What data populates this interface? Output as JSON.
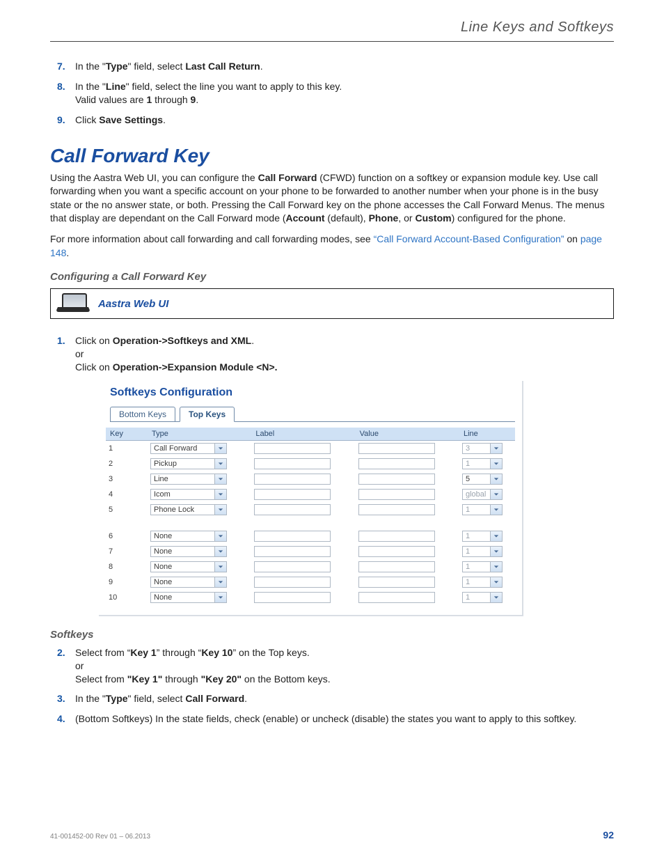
{
  "header": {
    "running_title": "Line Keys and Softkeys"
  },
  "intro_steps": [
    {
      "n": "7.",
      "pre": "In the \"",
      "bold1": "Type",
      "mid": "\" field, select ",
      "bold2": "Last Call Return",
      "post": "."
    },
    {
      "n": "8.",
      "pre": "In the \"",
      "bold1": "Line",
      "mid": "\" field, select the line you want to apply to this key.",
      "sub_pre": "Valid values are ",
      "sub_b1": "1",
      "sub_mid": " through ",
      "sub_b2": "9",
      "sub_post": "."
    },
    {
      "n": "9.",
      "pre": "Click ",
      "bold1": "Save Settings",
      "post": "."
    }
  ],
  "section": {
    "heading": "Call Forward Key",
    "p1_a": "Using the Aastra Web UI, you can configure the ",
    "p1_b": "Call Forward",
    "p1_c": " (CFWD) function on a softkey or expansion module key. Use call forwarding when you want a specific account on your phone to be forwarded to another number when your phone is in the busy state or the no answer state, or both. Pressing the Call Forward key on the phone accesses the Call Forward Menus. The menus that display are dependant on the Call Forward mode (",
    "p1_d": "Account",
    "p1_e": " (default), ",
    "p1_f": "Phone",
    "p1_g": ", or ",
    "p1_h": "Custom",
    "p1_i": ") configured for the phone.",
    "p2_a": "For more information about call forwarding and call forwarding modes, see ",
    "p2_link": "“Call Forward Account-Based Configuration”",
    "p2_b": " on ",
    "p2_page": "page 148",
    "p2_c": "."
  },
  "configure": {
    "heading": "Configuring a Call Forward Key",
    "barTitle": "Aastra Web UI",
    "step1": {
      "n": "1.",
      "a": "Click on ",
      "b": "Operation->Softkeys and XML",
      "c": ".",
      "or": "or",
      "d": "Click on ",
      "e": "Operation->Expansion Module <N>."
    }
  },
  "panel": {
    "title": "Softkeys Configuration",
    "tabs": {
      "inactive": "Bottom Keys",
      "active": "Top Keys"
    },
    "columns": [
      "Key",
      "Type",
      "Label",
      "Value",
      "Line"
    ],
    "rows": [
      {
        "key": "1",
        "type": "Call Forward",
        "line": "3",
        "lineDim": true
      },
      {
        "key": "2",
        "type": "Pickup",
        "line": "1",
        "lineDim": true
      },
      {
        "key": "3",
        "type": "Line",
        "line": "5",
        "lineDim": false
      },
      {
        "key": "4",
        "type": "Icom",
        "line": "global",
        "lineDim": true
      },
      {
        "key": "5",
        "type": "Phone Lock",
        "line": "1",
        "lineDim": true
      },
      {
        "gap": true
      },
      {
        "key": "6",
        "type": "None",
        "line": "1",
        "lineDim": true
      },
      {
        "key": "7",
        "type": "None",
        "line": "1",
        "lineDim": true
      },
      {
        "key": "8",
        "type": "None",
        "line": "1",
        "lineDim": true
      },
      {
        "key": "9",
        "type": "None",
        "line": "1",
        "lineDim": true
      },
      {
        "key": "10",
        "type": "None",
        "line": "1",
        "lineDim": true
      }
    ]
  },
  "softkeys": {
    "heading": "Softkeys",
    "step2": {
      "n": "2.",
      "a": "Select from “",
      "b": "Key 1",
      "c": "” through “",
      "d": "Key 10",
      "e": "” on the Top keys.",
      "or": "or",
      "f": "Select from ",
      "g": "\"Key 1\"",
      "h": " through ",
      "i": "\"Key 20\"",
      "j": " on the Bottom keys."
    },
    "step3": {
      "n": "3.",
      "a": "In the \"",
      "b": "Type",
      "c": "\" field, select ",
      "d": "Call Forward",
      "e": "."
    },
    "step4": {
      "n": "4.",
      "a": "(Bottom Softkeys) In the state fields, check (enable) or uncheck (disable) the states you want to apply to this softkey."
    }
  },
  "footer": {
    "meta": "41-001452-00 Rev 01 – 06.2013",
    "page": "92"
  }
}
